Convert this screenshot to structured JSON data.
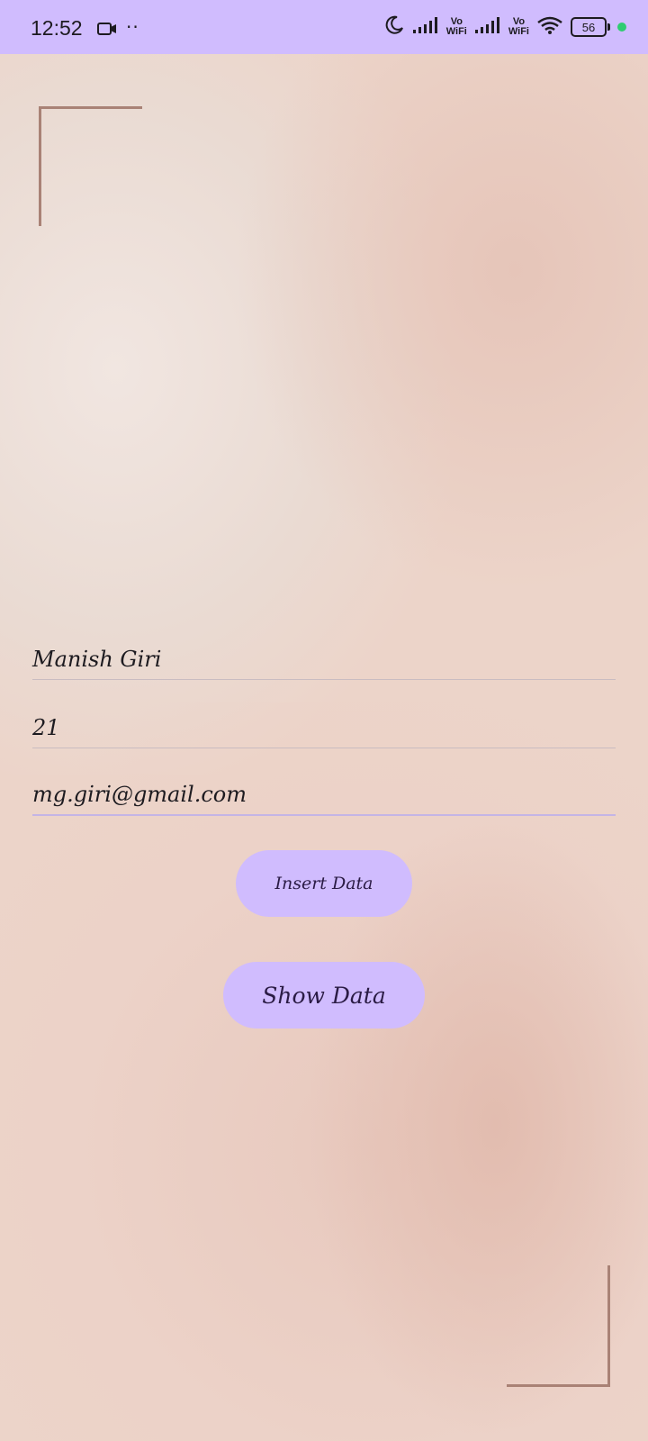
{
  "status_bar": {
    "time": "12:52",
    "extra_dots": "··",
    "vowifi_1": "Vo\nWiFi",
    "vowifi_2": "Vo\nWiFi",
    "battery": "56",
    "background_color": "#d0bcfe"
  },
  "form": {
    "name_value": "Manish Giri",
    "age_value": "21",
    "email_value": "mg.giri@gmail.com"
  },
  "buttons": {
    "insert_label": "Insert Data",
    "show_label": "Show Data",
    "color": "#d0bcfe"
  },
  "icons": [
    "video-camera-icon",
    "moon-icon",
    "signal-icon",
    "wifi-icon",
    "battery-icon"
  ]
}
